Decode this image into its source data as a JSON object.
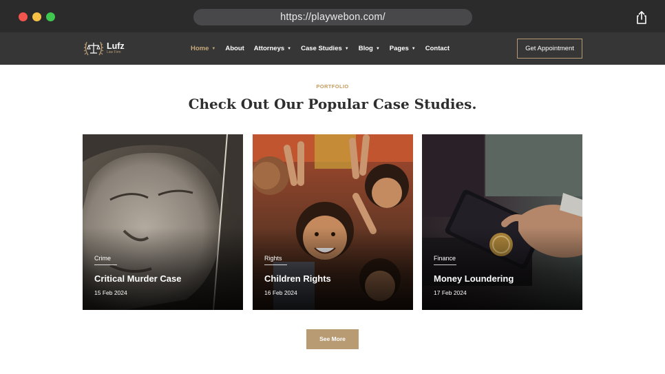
{
  "browser": {
    "url": "https://playwebon.com/"
  },
  "brand": {
    "name": "Lufz",
    "tagline": "Law Firm"
  },
  "nav": {
    "items": [
      {
        "label": "Home",
        "dropdown": true,
        "active": true
      },
      {
        "label": "About",
        "dropdown": false,
        "active": false
      },
      {
        "label": "Attorneys",
        "dropdown": true,
        "active": false
      },
      {
        "label": "Case Studies",
        "dropdown": true,
        "active": false
      },
      {
        "label": "Blog",
        "dropdown": true,
        "active": false
      },
      {
        "label": "Pages",
        "dropdown": true,
        "active": false
      },
      {
        "label": "Contact",
        "dropdown": false,
        "active": false
      }
    ],
    "cta_label": "Get Appointment"
  },
  "section": {
    "eyebrow": "PORTFOLIO",
    "title": "Check Out Our Popular Case Studies."
  },
  "cards": [
    {
      "category": "Crime",
      "title": "Critical Murder Case",
      "date": "15 Feb 2024"
    },
    {
      "category": "Rights",
      "title": "Children Rights",
      "date": "16 Feb 2024"
    },
    {
      "category": "Finance",
      "title": "Money Loundering",
      "date": "17 Feb 2024"
    }
  ],
  "see_more_label": "See More",
  "colors": {
    "accent": "#b89b72",
    "nav_bg": "#363636",
    "chrome_bg": "#2b2b2c",
    "heading": "#2e2e2e"
  },
  "icons": {
    "share": "share-icon",
    "caret": "chevron-down-icon",
    "logo": "scales-of-justice-icon"
  }
}
